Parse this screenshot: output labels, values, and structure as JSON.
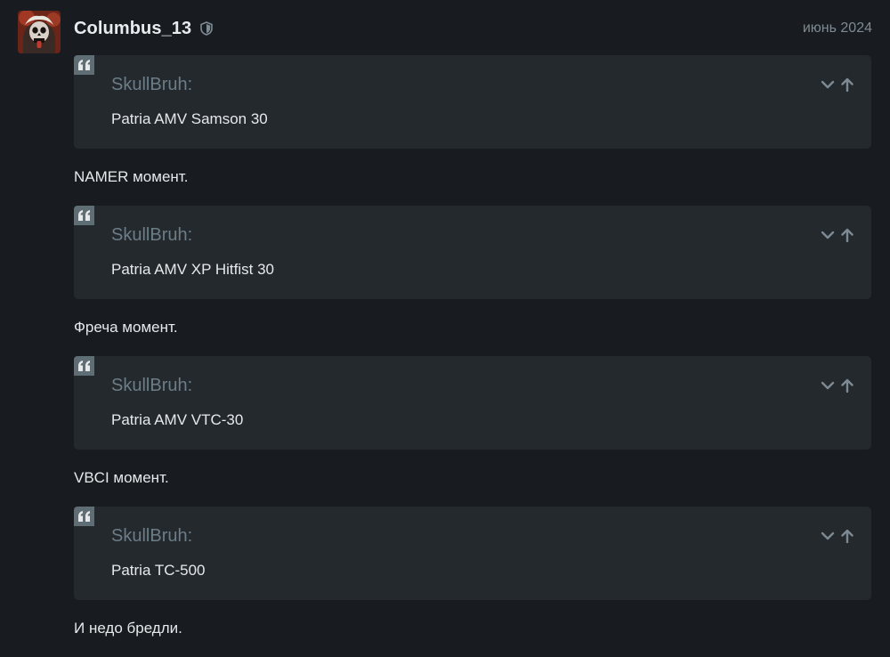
{
  "post": {
    "username": "Columbus_13",
    "date": "июнь 2024",
    "avatar_icon": "skull-avatar",
    "badge_icon": "shield-icon",
    "quotes": [
      {
        "author": "SkullBruh:",
        "text": "Patria AMV Samson 30",
        "reply": "NAMER момент."
      },
      {
        "author": "SkullBruh:",
        "text": "Patria AMV XP Hitfist 30",
        "reply": "Фреча момент."
      },
      {
        "author": "SkullBruh:",
        "text": "Patria AMV VTC-30",
        "reply": "VBCI момент."
      },
      {
        "author": "SkullBruh:",
        "text": "Patria TC-500",
        "reply": "И недо бредли."
      }
    ]
  },
  "colors": {
    "background": "#181c20",
    "quote_bg": "#24292e",
    "quote_mark_bg": "#5f6d75",
    "muted": "#6c7d87"
  }
}
